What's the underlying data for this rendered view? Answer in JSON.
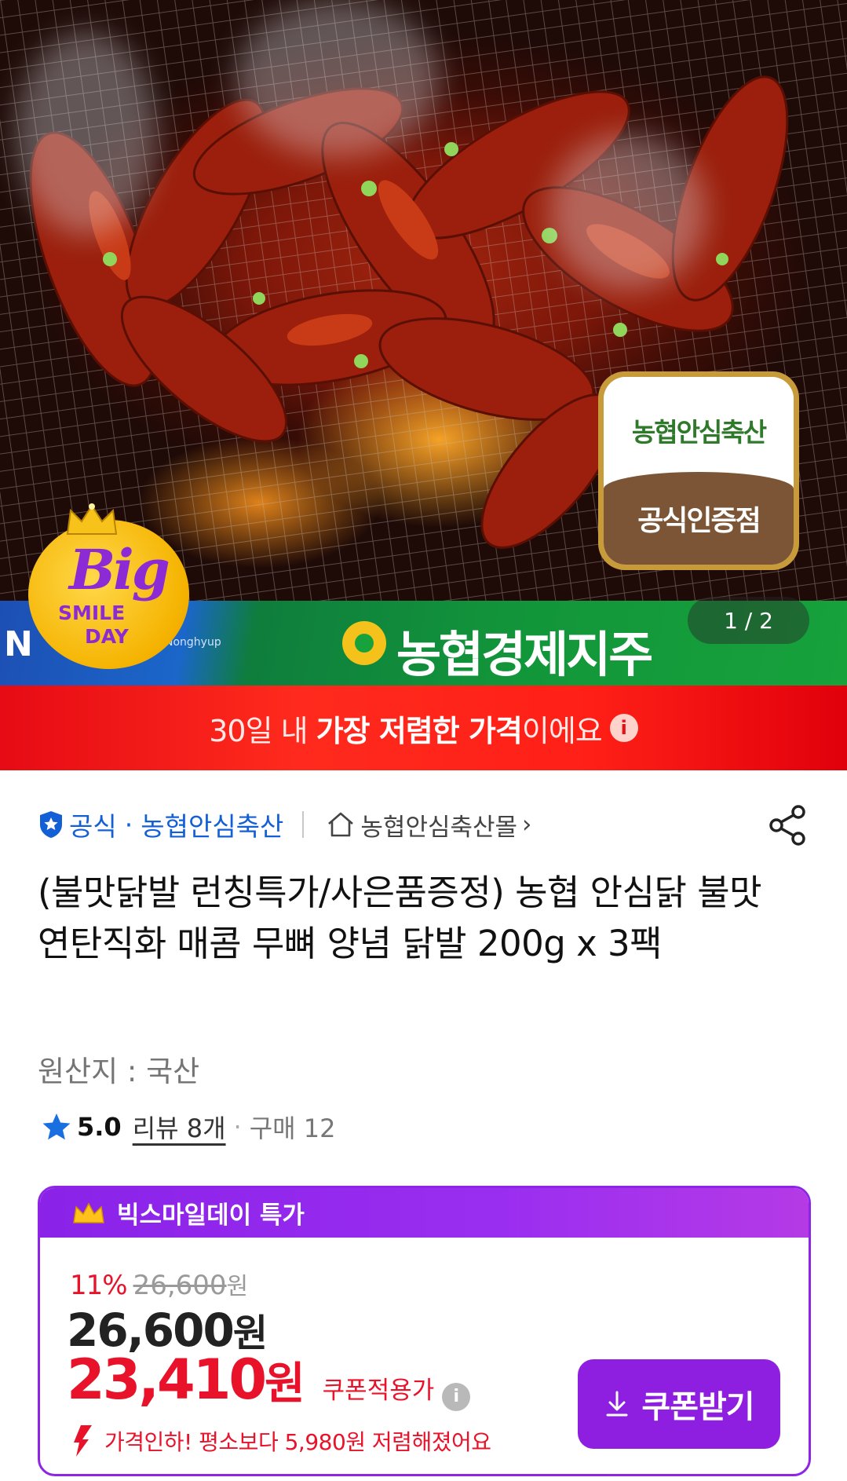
{
  "hero": {
    "cert_top": "농협안심축산",
    "cert_bottom": "공식인증점",
    "banner_nh": "N",
    "banner_nh_sub": "Nonghyup",
    "banner_brand": "농협경제지주",
    "pager": "1 / 2",
    "badge_big": "Big",
    "badge_smile": "SMILE",
    "badge_day": "DAY"
  },
  "lowest": {
    "prefix": "30일 내 ",
    "highlight": "가장 저렴한 가격",
    "suffix": "이에요",
    "info": "i"
  },
  "seller": {
    "official": "공식",
    "dot": "·",
    "name": "농협안심축산",
    "mall": "농협안심축산몰",
    "chevron": "›"
  },
  "product": {
    "title": "(불맛닭발 런칭특가/사은품증정) 농협 안심닭 불맛 연탄직화 매콤 무뼈 양념 닭발 200g x 3팩",
    "origin": "원산지 : 국산",
    "rating": "5.0",
    "review": "리뷰 8개",
    "separator": "·",
    "purchase": "구매 12"
  },
  "deal": {
    "title": "빅스마일데이 특가",
    "discount_rate": "11%",
    "original_price": "26,600",
    "original_won": "원",
    "sale_price": "26,600",
    "sale_won": "원",
    "coupon_price": "23,410",
    "coupon_won": "원",
    "coupon_label": "쿠폰적용가",
    "coupon_info": "i",
    "drop_text": "가격인하! 평소보다 5,980원 저렴해졌어요",
    "coupon_button": "쿠폰받기"
  },
  "colors": {
    "accent_purple": "#8e1fe0",
    "price_red": "#e8132a",
    "seller_blue": "#1360d6",
    "banner_red": "#ff2a1d",
    "star_blue": "#1a6fe0"
  },
  "icons": [
    "shield-icon",
    "home-icon",
    "share-icon",
    "star-icon",
    "crown-icon",
    "info-icon",
    "down-arrow-icon",
    "download-icon"
  ]
}
